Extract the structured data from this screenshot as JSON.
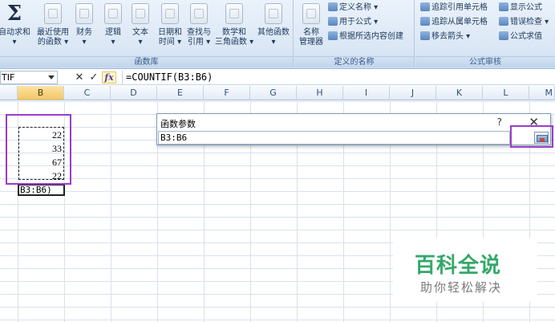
{
  "ribbon": {
    "autosum": {
      "line1": "自动求和",
      "line2": "▾"
    },
    "recent": {
      "line1": "最近使用",
      "line2": "的函数 ▾"
    },
    "finance": {
      "line1": "财务",
      "line2": "▾"
    },
    "logical": {
      "line1": "逻辑",
      "line2": "▾"
    },
    "text": {
      "line1": "文本",
      "line2": "▾"
    },
    "datetime": {
      "line1": "日期和",
      "line2": "时间 ▾"
    },
    "lookup": {
      "line1": "查找与",
      "line2": "引用 ▾"
    },
    "math": {
      "line1": "数学和",
      "line2": "三角函数 ▾"
    },
    "other": {
      "line1": "其他函数",
      "line2": "▾"
    },
    "library_label": "函数库",
    "name_manager": {
      "line1": "名称",
      "line2": "管理器"
    },
    "define_name": "定义名称 ▾",
    "use_in_formula": "用于公式 ▾",
    "create_from_selection": "根据所选内容创建",
    "defined_names_label": "定义的名称",
    "trace_precedents": "追踪引用单元格",
    "trace_dependents": "追踪从属单元格",
    "remove_arrows": "移去箭头 ▾",
    "show_formulas": "显示公式",
    "error_checking": "错误检查 ▾",
    "evaluate_formula": "公式求值",
    "auditing_label": "公式审核"
  },
  "formula_bar": {
    "name_box": "TIF",
    "cancel": "✕",
    "enter": "✓",
    "fx": "fx",
    "formula": "=COUNTIF(B3:B6)"
  },
  "columns": [
    "B",
    "C",
    "D",
    "E",
    "F",
    "G",
    "H",
    "I",
    "J",
    "K",
    "L",
    "M"
  ],
  "cells": {
    "b3": "22",
    "b4": "33",
    "b5": "67",
    "b6": "22",
    "active_text": "B3:B6)"
  },
  "dialog": {
    "title": "函数参数",
    "help": "?",
    "close": "✕",
    "input_value": "B3:B6"
  },
  "watermark": {
    "main": "百科全说",
    "sub": "助你轻松解决"
  },
  "colors": {
    "highlight": "#9a3ccb",
    "selected_column": "#f5c660",
    "watermark_green": "#35a86a"
  }
}
